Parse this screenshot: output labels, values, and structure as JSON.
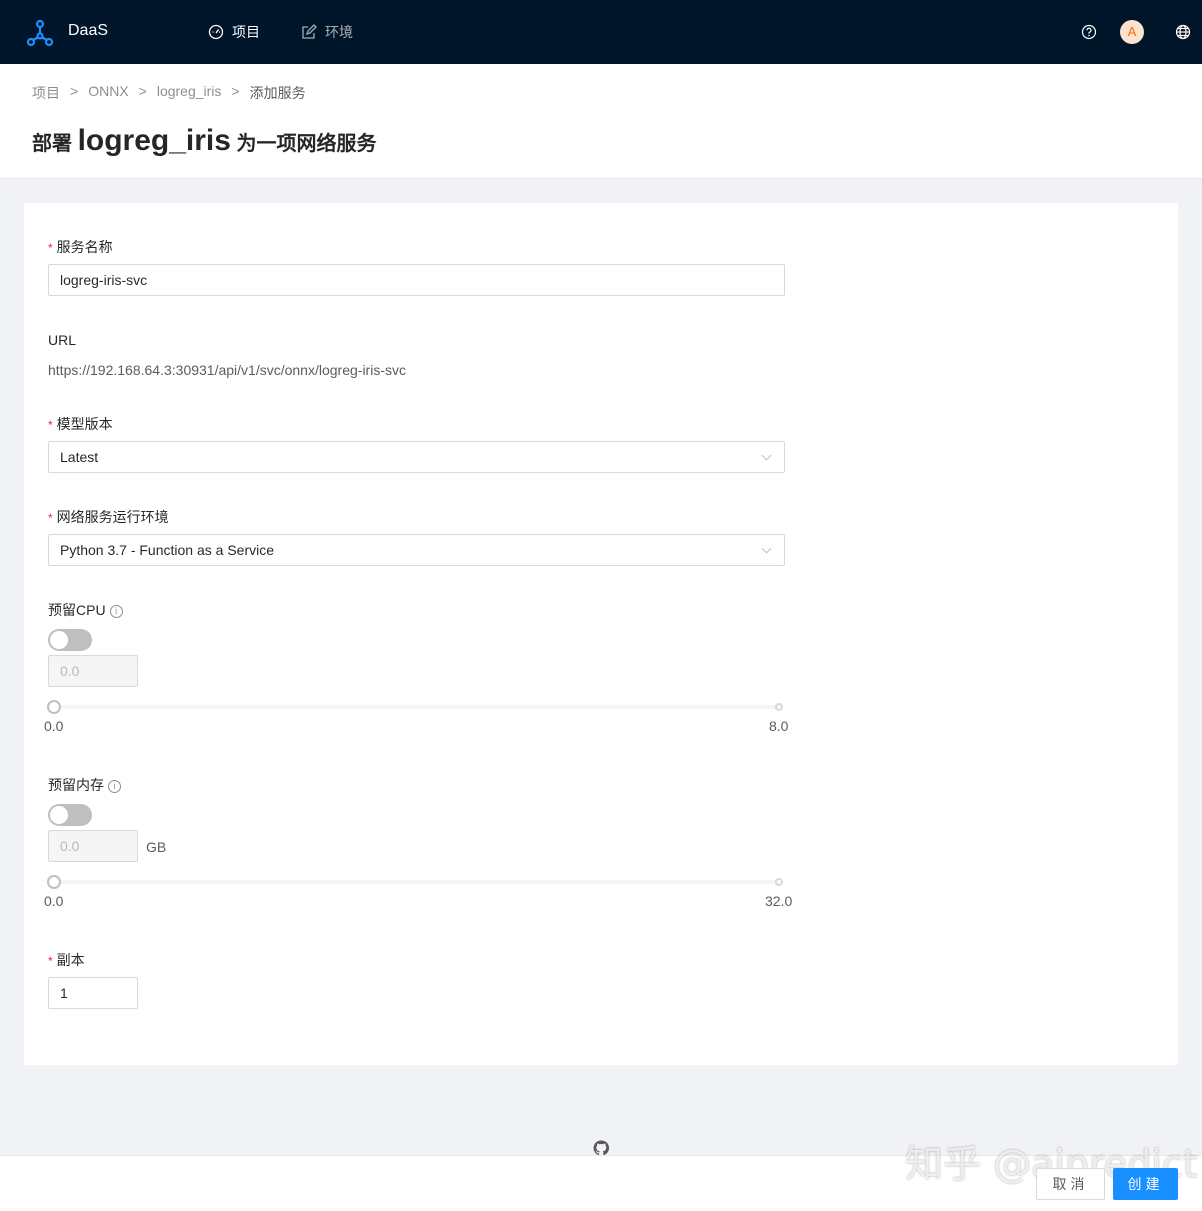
{
  "app": {
    "name": "DaaS"
  },
  "nav": [
    {
      "label": "项目",
      "icon": "dashboard-icon"
    },
    {
      "label": "环境",
      "icon": "edit-icon"
    }
  ],
  "user": {
    "avatar_initial": "A"
  },
  "breadcrumb": [
    "项目",
    "ONNX",
    "logreg_iris",
    "添加服务"
  ],
  "breadcrumb_sep": ">",
  "title": {
    "prefix": "部署",
    "model": "logreg_iris",
    "suffix": "为一项网络服务"
  },
  "form": {
    "service_name": {
      "label": "服务名称",
      "value": "logreg-iris-svc"
    },
    "url": {
      "label": "URL",
      "value": "https://192.168.64.3:30931/api/v1/svc/onnx/logreg-iris-svc"
    },
    "model_version": {
      "label": "模型版本",
      "value": "Latest"
    },
    "runtime": {
      "label": "网络服务运行环境",
      "value": "Python 3.7 - Function as a Service"
    },
    "cpu": {
      "label": "预留CPU",
      "enabled": false,
      "value": "0.0",
      "min": "0.0",
      "max": "8.0"
    },
    "memory": {
      "label": "预留内存",
      "enabled": false,
      "value": "0.0",
      "unit": "GB",
      "min": "0.0",
      "max": "32.0"
    },
    "replicas": {
      "label": "副本",
      "value": "1"
    }
  },
  "required_mark": "*",
  "actions": {
    "cancel": "取消",
    "create": "创建"
  },
  "watermark": "知乎 @aipredict",
  "colors": {
    "header_bg": "#001529",
    "primary": "#1890ff",
    "required": "#f5222d"
  }
}
